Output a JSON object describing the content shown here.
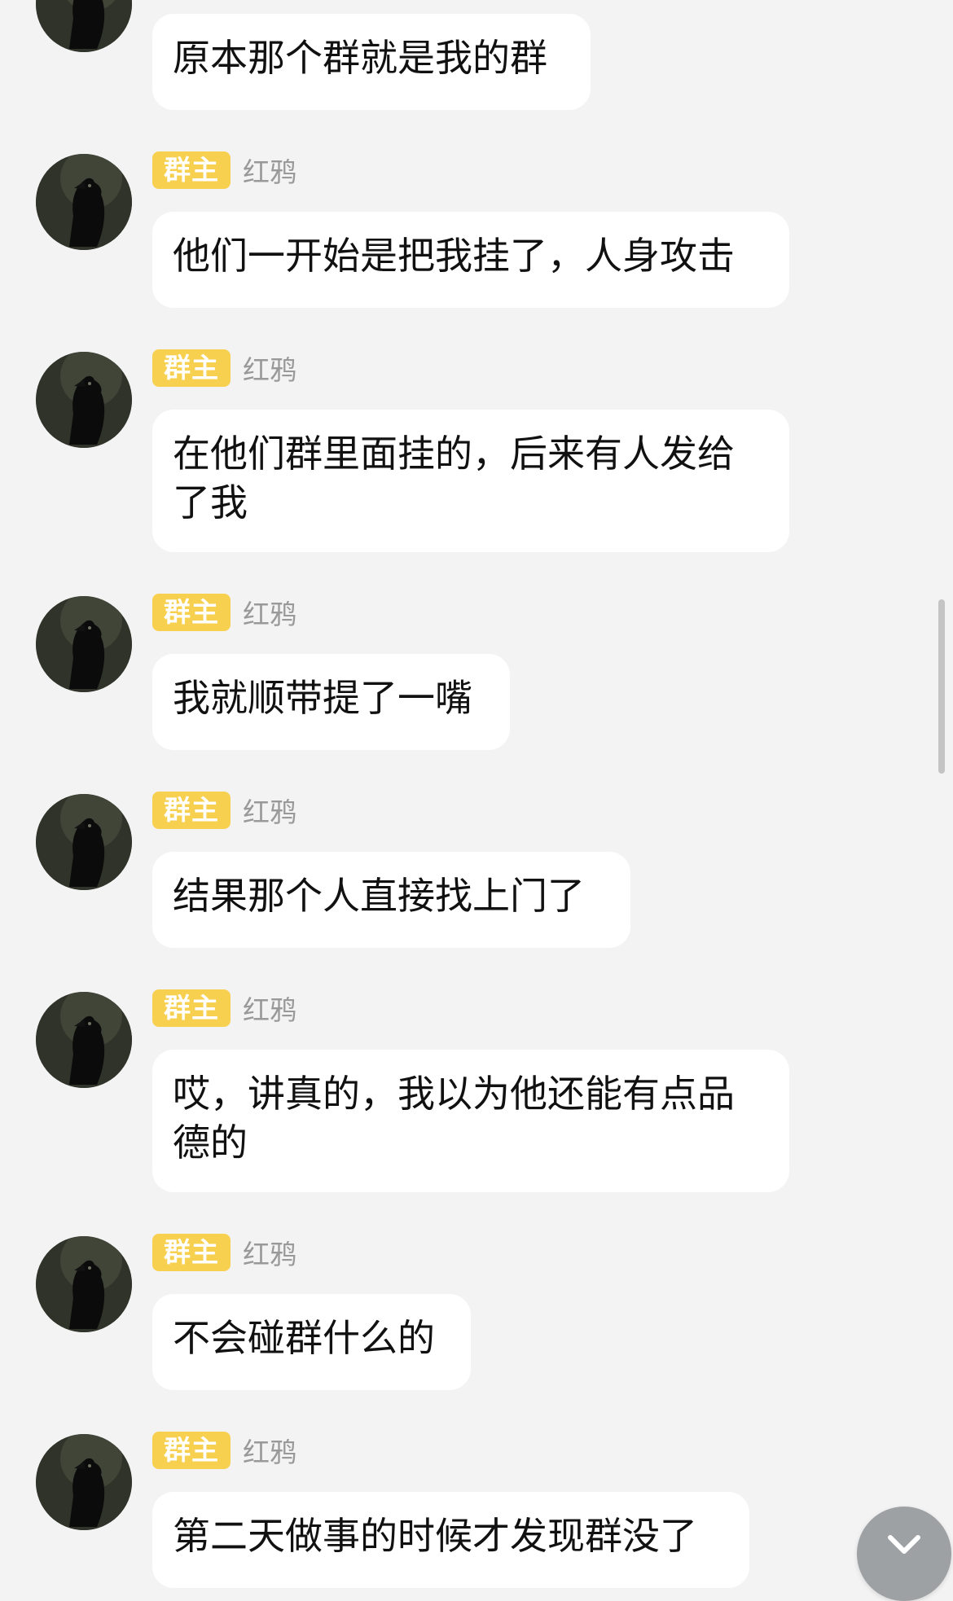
{
  "chat": {
    "messages": [
      {
        "text": "原本那个群就是我的群",
        "show_header": false
      },
      {
        "badge": "群主",
        "sender": "红鸦",
        "text": "他们一开始是把我挂了，人身攻击"
      },
      {
        "badge": "群主",
        "sender": "红鸦",
        "text": "在他们群里面挂的，后来有人发给了我"
      },
      {
        "badge": "群主",
        "sender": "红鸦",
        "text": "我就顺带提了一嘴"
      },
      {
        "badge": "群主",
        "sender": "红鸦",
        "text": "结果那个人直接找上门了"
      },
      {
        "badge": "群主",
        "sender": "红鸦",
        "text": "哎，讲真的，我以为他还能有点品德的"
      },
      {
        "badge": "群主",
        "sender": "红鸦",
        "text": "不会碰群什么的"
      },
      {
        "badge": "群主",
        "sender": "红鸦",
        "text": "第二天做事的时候才发现群没了"
      }
    ]
  },
  "icons": {
    "avatar": "crow-avatar-image",
    "scroll_down": "chevron-down-icon"
  }
}
